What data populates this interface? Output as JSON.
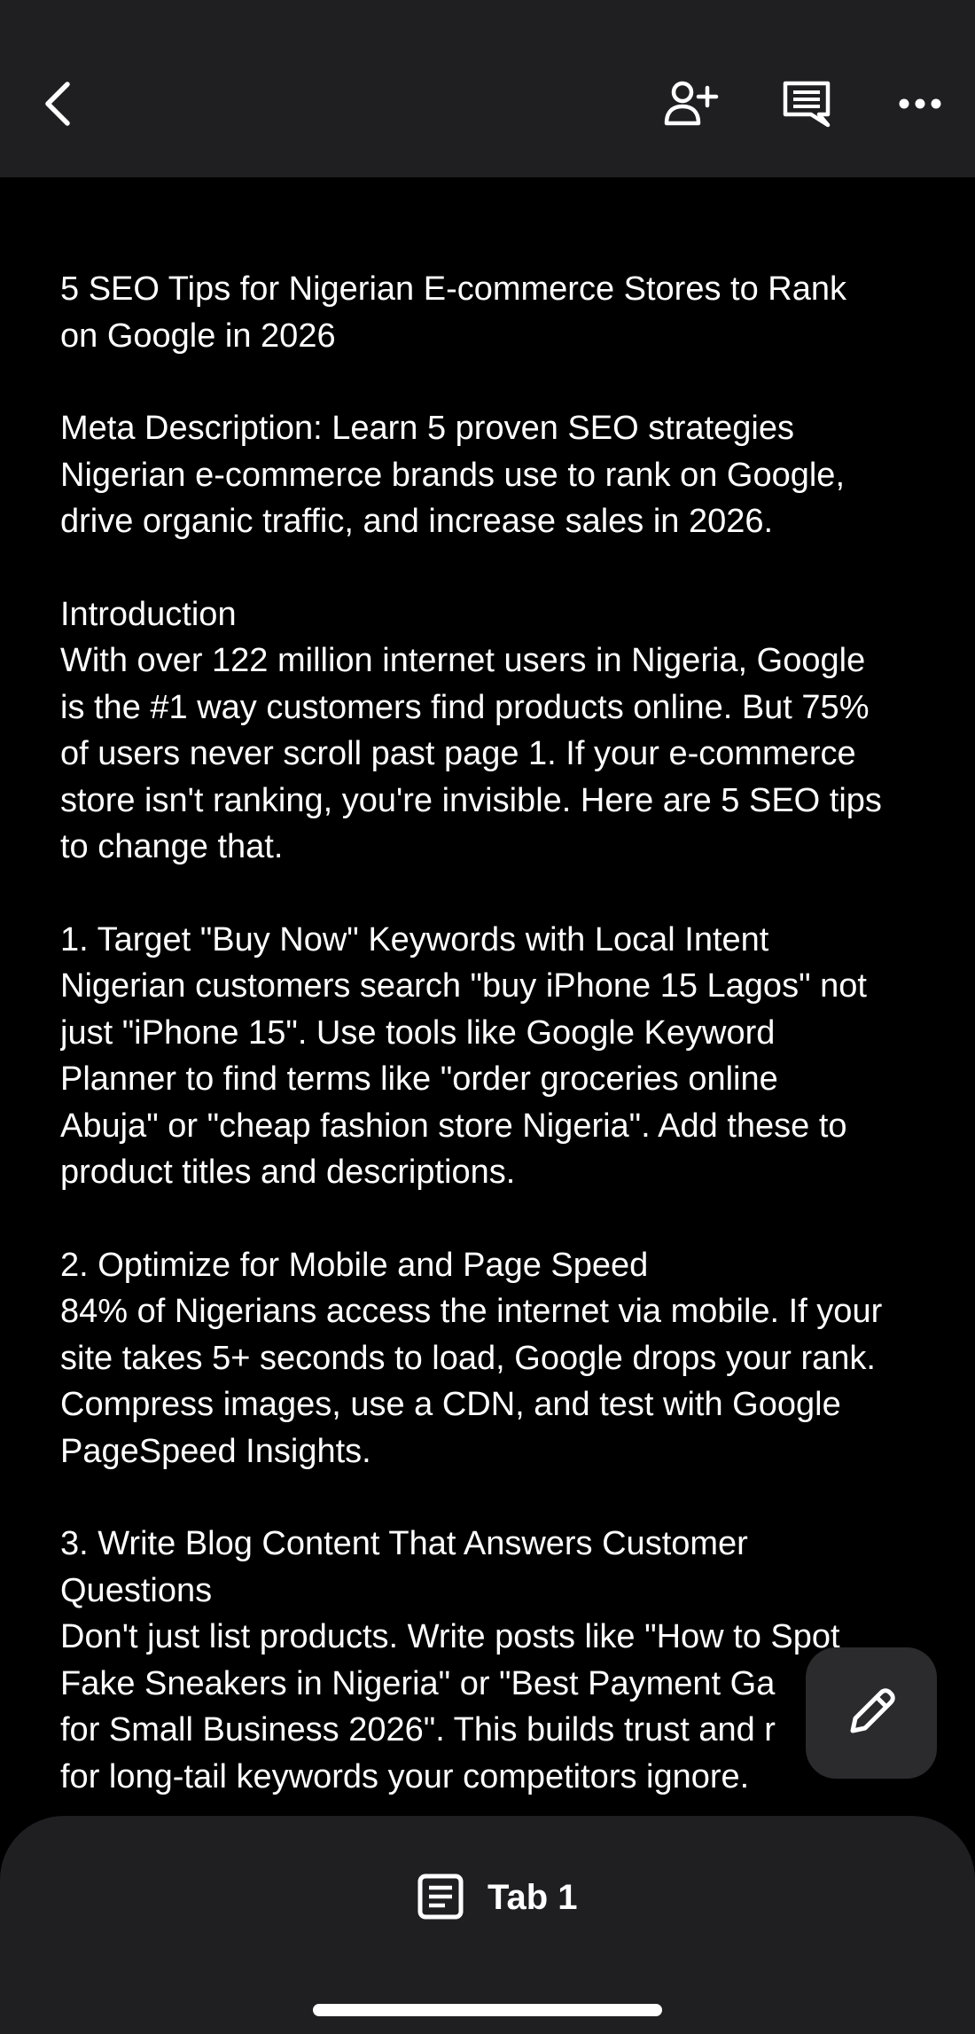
{
  "toolbar": {
    "back_icon": "chevron-left-icon",
    "share_icon": "add-person-icon",
    "comments_icon": "comment-icon",
    "more_icon": "more-horizontal-icon"
  },
  "document": {
    "title": [
      "5 SEO Tips for Nigerian E-commerce Stores to Rank",
      "on Google in 2026"
    ],
    "meta": [
      "Meta Description: Learn 5 proven SEO strategies",
      "Nigerian e-commerce brands use to rank on Google,",
      "drive organic traffic, and increase sales in 2026."
    ],
    "intro": [
      "Introduction",
      "With over 122 million internet users in Nigeria, Google",
      "is the #1 way customers find products online. But 75%",
      "of users never scroll past page 1. If your e-commerce",
      "store isn't ranking, you're invisible. Here are 5 SEO tips",
      "to change that."
    ],
    "tip1": [
      "1. Target \"Buy Now\" Keywords with Local Intent",
      "Nigerian customers search \"buy iPhone 15 Lagos\" not",
      "just \"iPhone 15\". Use tools like Google Keyword",
      "Planner to find terms like \"order groceries online",
      "Abuja\" or \"cheap fashion store Nigeria\". Add these to",
      "product titles and descriptions."
    ],
    "tip2": [
      "2. Optimize for Mobile and Page Speed",
      "84% of Nigerians access the internet via mobile. If your",
      "site takes 5+ seconds to load, Google drops your rank.",
      "Compress images, use a CDN, and test with Google",
      "PageSpeed Insights."
    ],
    "tip3": [
      "3. Write Blog Content That Answers Customer",
      "Questions",
      "Don't just list products. Write posts like \"How to Spot",
      "Fake Sneakers in Nigeria\" or \"Best Payment Ga",
      "for Small Business 2026\". This builds trust and r",
      "for long-tail keywords your competitors ignore."
    ]
  },
  "fab": {
    "icon": "pencil-icon"
  },
  "bottom": {
    "tab_icon": "document-icon",
    "tab_label": "Tab 1"
  },
  "colors": {
    "background": "#000000",
    "bar": "#1f1f22",
    "fab": "#2b2b2e",
    "text": "#ffffff"
  }
}
